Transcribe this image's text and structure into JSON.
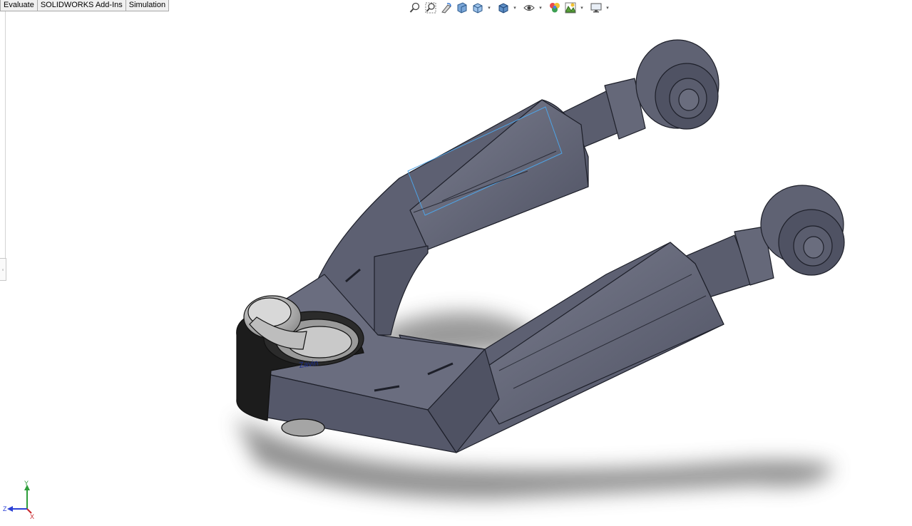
{
  "tabs": [
    {
      "label": "Evaluate"
    },
    {
      "label": "SOLIDWORKS Add-Ins"
    },
    {
      "label": "Simulation"
    }
  ],
  "heads_up_toolbar": [
    "zoom-to-fit-icon",
    "zoom-to-area-icon",
    "previous-view-icon",
    "section-view-icon",
    "view-orientation-icon",
    "display-style-icon",
    "hide-show-items-icon",
    "edit-appearance-icon",
    "apply-scene-icon",
    "view-settings-icon"
  ],
  "model": {
    "engraved_text": "Zavin"
  },
  "triad": {
    "x_label": "X",
    "y_label": "Y",
    "z_label": "Z"
  },
  "colors": {
    "part_body": "#5d6072",
    "part_edge": "#1d1f29",
    "bushing_black": "#1c1c1c",
    "selection_blue": "#4ea3e6"
  }
}
